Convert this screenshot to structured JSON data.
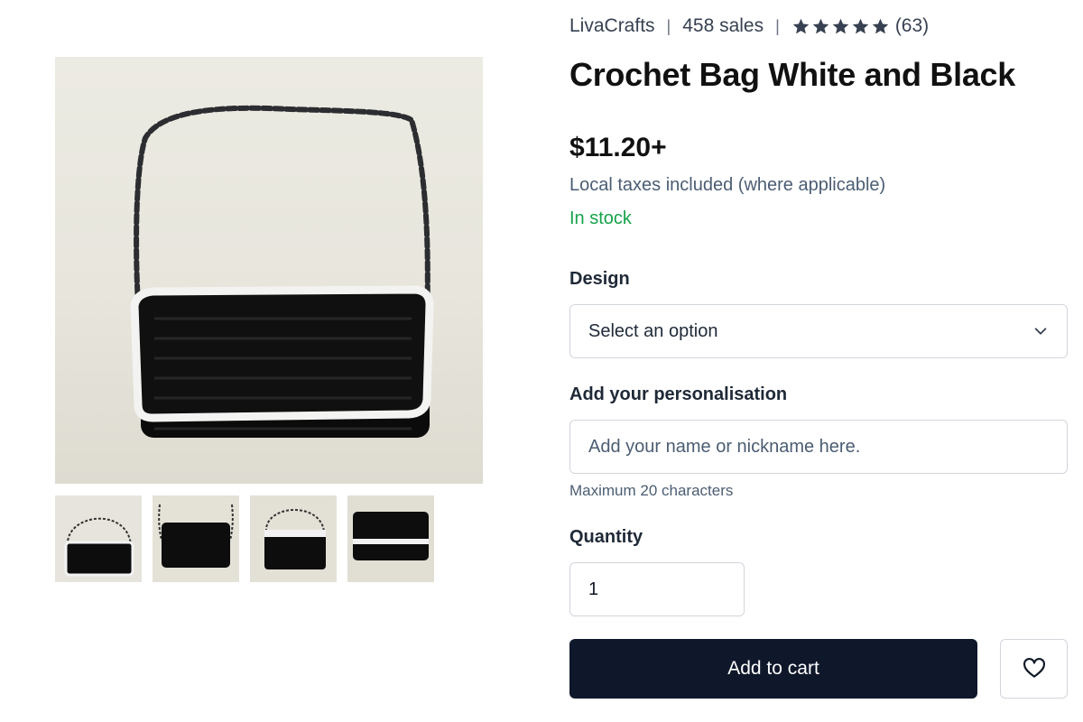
{
  "shop": {
    "name": "LivaCrafts",
    "sales": "458 sales",
    "rating_stars": 5,
    "review_count": "(63)"
  },
  "product": {
    "title": "Crochet Bag White and Black",
    "price": "$11.20+",
    "taxes_note": "Local taxes included (where applicable)",
    "stock_status": "In stock"
  },
  "gallery": {
    "thumbnail_count": 4,
    "selected_index": 0
  },
  "form": {
    "design_label": "Design",
    "design_selected": "Select an option",
    "personalisation_label": "Add your personalisation",
    "personalisation_placeholder": "Add your name or nickname here.",
    "personalisation_hint": "Maximum 20 characters",
    "quantity_label": "Quantity",
    "quantity_value": "1"
  },
  "actions": {
    "add_to_cart": "Add to cart"
  },
  "colors": {
    "accent_dark": "#0f172a",
    "stock_green": "#16a34a",
    "muted_text": "#4b5d73"
  }
}
